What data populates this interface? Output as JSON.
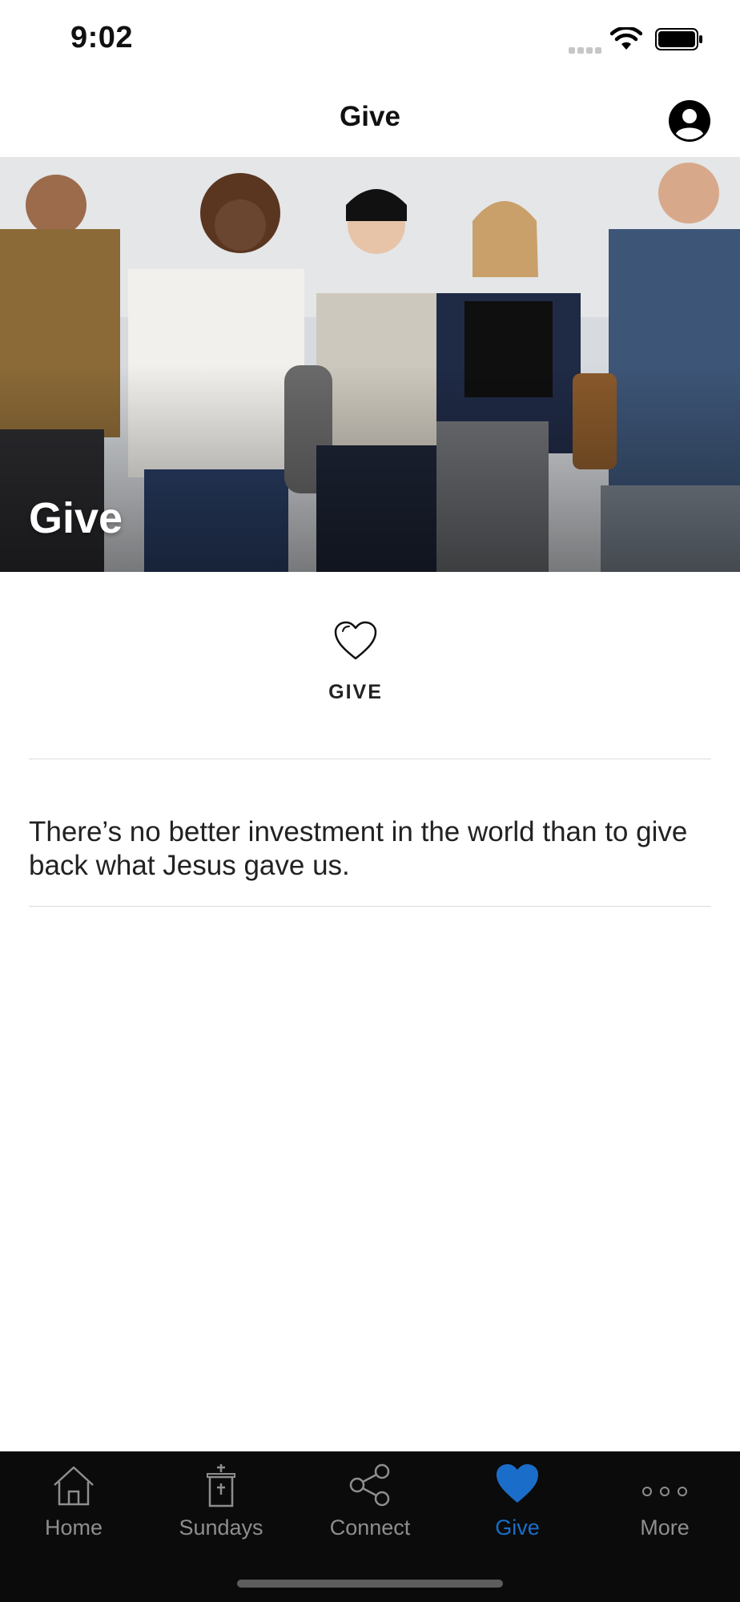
{
  "status": {
    "time": "9:02"
  },
  "nav": {
    "title": "Give"
  },
  "hero": {
    "title": "Give"
  },
  "give_tile": {
    "label": "GIVE"
  },
  "description": "There’s no better investment in the world than to give back what Jesus gave us.",
  "tabs": [
    {
      "label": "Home",
      "icon": "home-icon"
    },
    {
      "label": "Sundays",
      "icon": "church-icon"
    },
    {
      "label": "Connect",
      "icon": "share-icon"
    },
    {
      "label": "Give",
      "icon": "heart-icon",
      "active": true
    },
    {
      "label": "More",
      "icon": "more-icon"
    }
  ],
  "colors": {
    "accent": "#1a6ec9",
    "tabbar": "#0b0b0b",
    "inactive": "#8e8e8e"
  }
}
